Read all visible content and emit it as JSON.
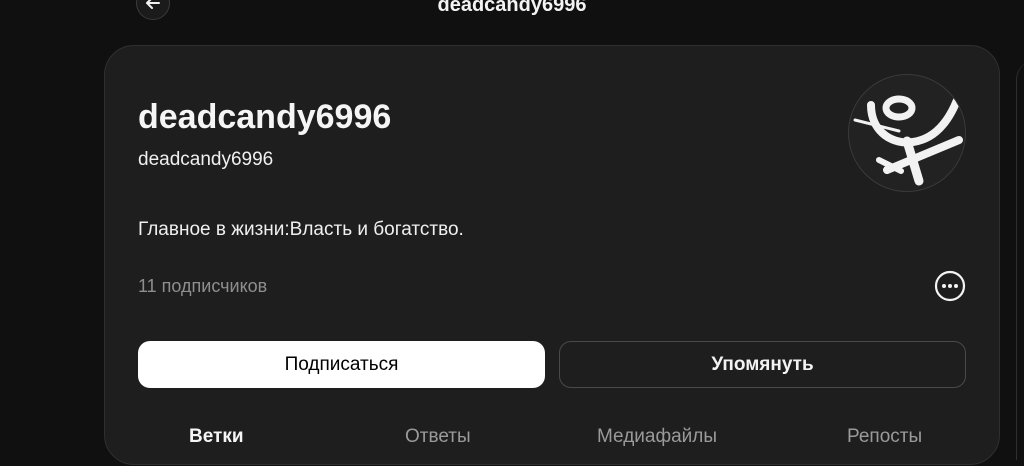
{
  "header": {
    "title": "deadcandy6996",
    "back_icon": "arrow-left-icon"
  },
  "profile": {
    "display_name": "deadcandy6996",
    "username": "deadcandy6996",
    "bio": "Главное в жизни:Власть и богатство.",
    "followers": "11 подписчиков",
    "avatar_icon": "avatar-image",
    "more_icon": "more-options-icon"
  },
  "actions": {
    "follow_label": "Подписаться",
    "mention_label": "Упомянуть"
  },
  "tabs": [
    {
      "label": "Ветки"
    },
    {
      "label": "Ответы"
    },
    {
      "label": "Медиафайлы"
    },
    {
      "label": "Репосты"
    }
  ],
  "colors": {
    "background": "#101010",
    "card": "#1e1e1e",
    "follow_button": "#ffffff",
    "muted_text": "#8e8e8e"
  }
}
